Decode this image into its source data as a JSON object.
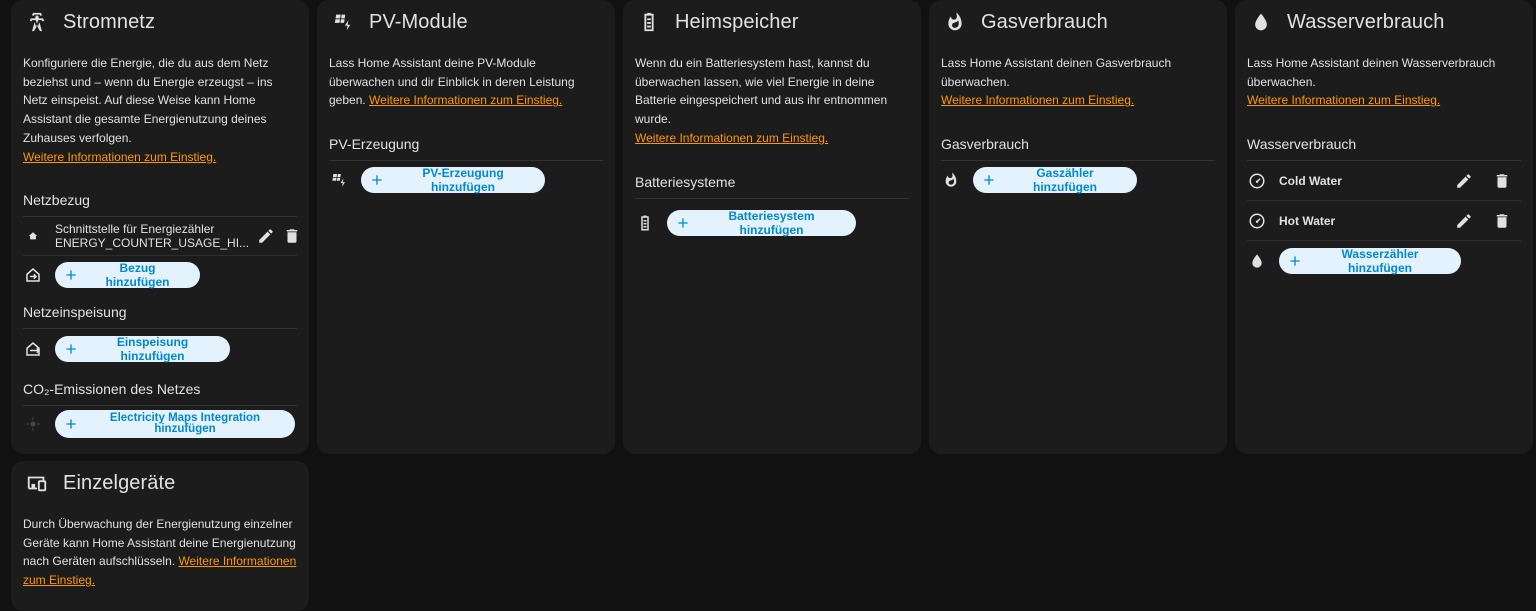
{
  "cards": {
    "grid": {
      "title": "Stromnetz",
      "desc": "Konfiguriere die Energie, die du aus dem Netz beziehst und – wenn du Energie erzeugst – ins Netz einspeist. Auf diese Weise kann Home Assistant die gesamte Energienutzung deines Zuhauses verfolgen.",
      "link": "Weitere Informationen zum Einstieg.",
      "consumption_title": "Netzbezug",
      "consumption_entity_line1": "Schnittstelle für Energiezähler",
      "consumption_entity_line2": "ENERGY_COUNTER_USAGE_HI...",
      "add_consumption": "Bezug hinzufügen",
      "return_title": "Netzeinspeisung",
      "add_return": "Einspeisung hinzufügen",
      "co2_title": "CO₂-Emissionen des Netzes",
      "add_co2": "Electricity Maps Integration hinzufügen"
    },
    "solar": {
      "title": "PV-Module",
      "desc": "Lass Home Assistant deine PV-Module überwachen und dir Einblick in deren Leistung geben.",
      "link": "Weitere Informationen zum Einstieg.",
      "section_title": "PV-Erzeugung",
      "add": "PV-Erzeugung hinzufügen"
    },
    "battery": {
      "title": "Heimspeicher",
      "desc": "Wenn du ein Batteriesystem hast, kannst du überwachen lassen, wie viel Energie in deine Batterie eingespeichert und aus ihr entnommen wurde.",
      "link": "Weitere Informationen zum Einstieg.",
      "section_title": "Batteriesysteme",
      "add": "Batteriesystem hinzufügen"
    },
    "gas": {
      "title": "Gasverbrauch",
      "desc": "Lass Home Assistant deinen Gasverbrauch überwachen.",
      "link": "Weitere Informationen zum Einstieg.",
      "section_title": "Gasverbrauch",
      "add": "Gaszähler hinzufügen"
    },
    "water": {
      "title": "Wasserverbrauch",
      "desc": "Lass Home Assistant deinen Wasserverbrauch überwachen.",
      "link": "Weitere Informationen zum Einstieg.",
      "section_title": "Wasserverbrauch",
      "meters": [
        "Cold Water",
        "Hot Water"
      ],
      "add": "Wasserzähler hinzufügen"
    },
    "devices": {
      "title": "Einzelgeräte",
      "desc": "Durch Überwachung der Energienutzung einzelner Geräte kann Home Assistant deine Energienutzung nach Geräten aufschlüsseln.",
      "link": "Weitere Informationen zum Einstieg."
    }
  },
  "colors": {
    "background": "#111111",
    "card": "#1c1c1c",
    "link": "#ff9800",
    "button_bg": "#e3f2fd",
    "button_text": "#0288d1"
  },
  "icons": {
    "grid": "transmission-tower-icon",
    "solar": "solar-power-icon",
    "battery": "battery-icon",
    "gas": "fire-icon",
    "water": "water-drop-icon",
    "devices": "devices-icon",
    "edit": "pencil-icon",
    "delete": "trash-icon",
    "meter": "gauge-icon",
    "add": "plus-icon"
  }
}
